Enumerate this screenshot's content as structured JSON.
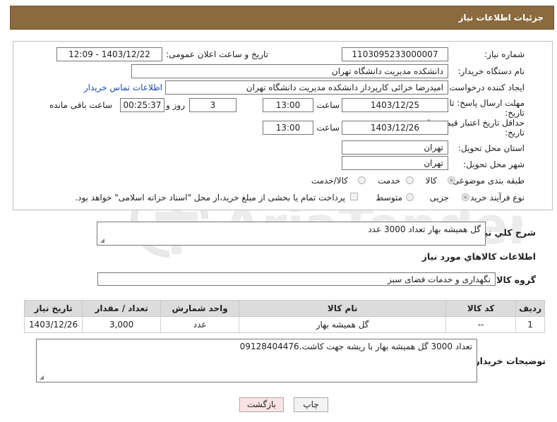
{
  "header": {
    "title": "جزئیات اطلاعات نیاز"
  },
  "form": {
    "need_number_label": "شماره نیاز:",
    "need_number": "1103095233000007",
    "announce_label": "تاریخ و ساعت اعلان عمومی:",
    "announce_value": "1403/12/22 - 12:09",
    "buyer_org_label": "نام دستگاه خریدار:",
    "buyer_org": "دانشکده مدیریت دانشگاه تهران",
    "creator_label": "ایجاد کننده درخواست:",
    "creator": "امیدرضا خزائی کارپرداز دانشکده مدیریت دانشگاه تهران",
    "contact_link": "اطلاعات تماس خریدار",
    "deadline_label_1": "مهلت ارسال پاسخ: تا",
    "deadline_label_2": "تاریخ:",
    "deadline_date": "1403/12/25",
    "time_label": "ساعت",
    "deadline_time": "13:00",
    "days_value": "3",
    "days_label": "روز و",
    "remaining_time": "00:25:37",
    "remaining_label": "ساعت باقی مانده",
    "price_label_1": "حداقل تاریخ اعتبار قیمت: تا",
    "price_label_2": "تاریخ:",
    "price_date": "1403/12/26",
    "price_time": "13:00",
    "province_label": "استان محل تحویل:",
    "province": "تهران",
    "city_label": "شهر محل تحویل:",
    "city": "تهران",
    "category_label": "طبقه بندی موضوعی:",
    "category_options": [
      "کالا",
      "خدمت",
      "کالا/خدمت"
    ],
    "process_label": "نوع فرآیند خرید :",
    "process_options": [
      "جزیی",
      "متوسط"
    ],
    "payment_note": "پرداخت تمام یا بخشی از مبلغ خرید،از محل \"اسناد خزانه اسلامی\" خواهد بود."
  },
  "summary": {
    "label": "شرح کلي نياز:",
    "text": "گل همیشه بهار تعداد 3000 عدد"
  },
  "goods": {
    "section_title": "اطلاعات کالاهاي مورد نياز",
    "group_label": "گروه کالا:",
    "group_value": "نگهداری و خدمات فضای سبز",
    "columns": [
      "رديف",
      "کد کالا",
      "نام کالا",
      "واحد شمارش",
      "تعداد / مقدار",
      "تاریخ نیاز"
    ],
    "rows": [
      [
        "1",
        "--",
        "گل همیشه بهار",
        "عدد",
        "3,000",
        "1403/12/26"
      ]
    ]
  },
  "notes": {
    "label": "توضیحات خریدار:",
    "text": "تعداد 3000 گل همیشه بهار با ریشه جهت کاشت.09128404476"
  },
  "buttons": {
    "print": "چاپ",
    "back": "بازگشت"
  },
  "colors": {
    "header_bg": "#8a6a3e",
    "link": "#1a4aa8",
    "back_button_bg": "#fbe3e3"
  },
  "icons": {
    "watermark": "ariatender-logo"
  }
}
